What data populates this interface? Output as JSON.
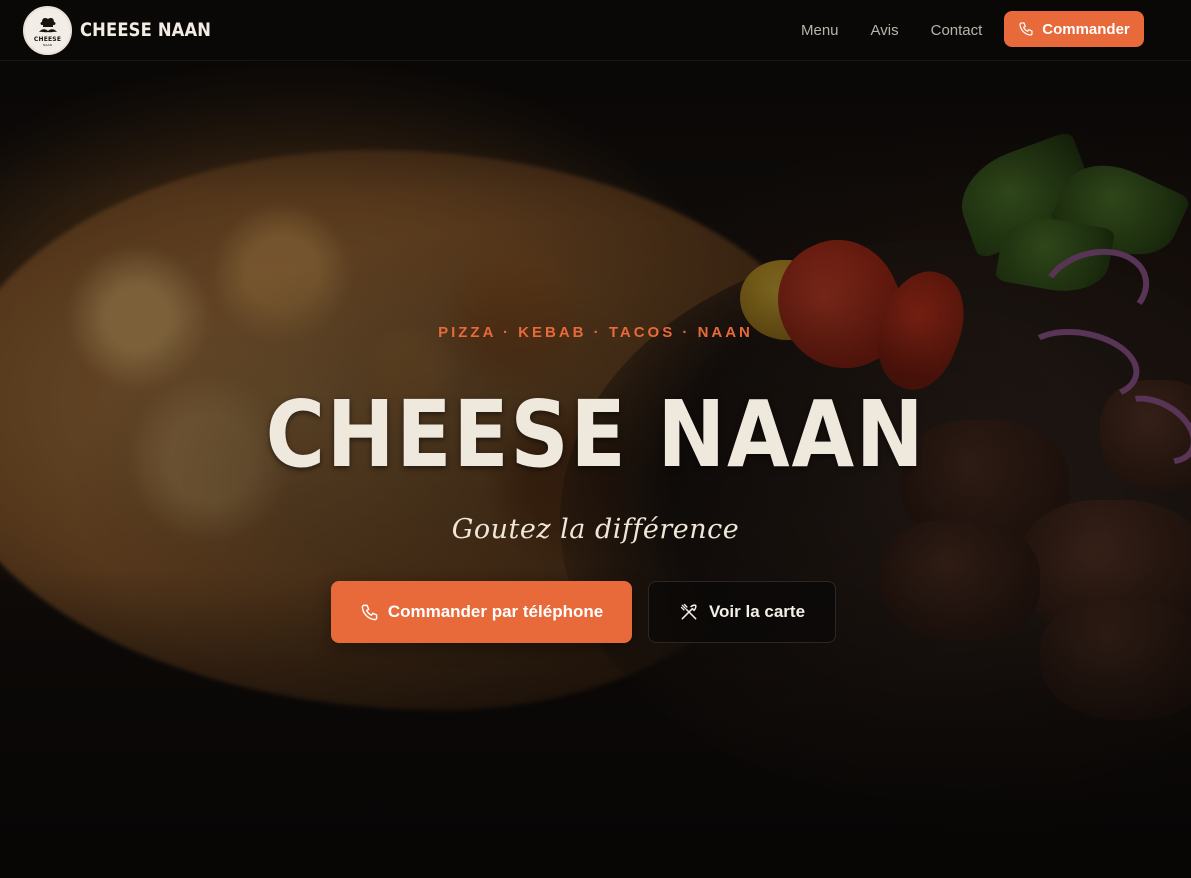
{
  "brand": {
    "name": "CHEESE NAAN",
    "logo_text": "CHEESE",
    "logo_subtext": "NAAN",
    "logo_icon": "chef-mustache-icon"
  },
  "nav": {
    "links": [
      "Menu",
      "Avis",
      "Contact"
    ],
    "cta_label": "Commander",
    "cta_icon": "phone-icon"
  },
  "hero": {
    "tagline": "PIZZA · KEBAB · TACOS · NAAN",
    "title": "CHEESE NAAN",
    "subtitle": "Goutez la différence",
    "primary_button": {
      "label": "Commander par téléphone",
      "icon": "phone-icon"
    },
    "secondary_button": {
      "label": "Voir la carte",
      "icon": "utensils-crossed-icon"
    }
  },
  "colors": {
    "accent": "#e8693a",
    "background": "#0b0908",
    "title_text": "#efe8dd",
    "nav_text": "#b9b2aa"
  }
}
